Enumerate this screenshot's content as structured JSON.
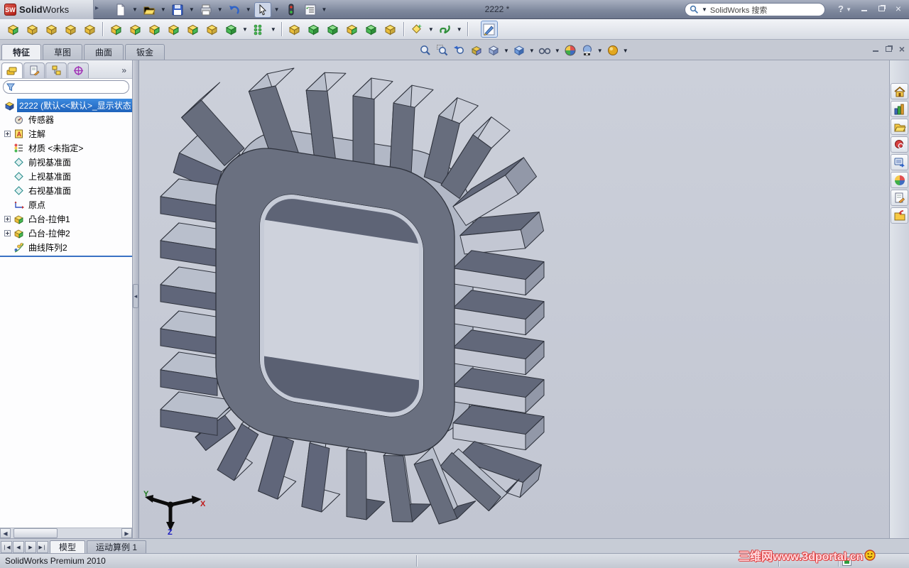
{
  "titlebar": {
    "app_name_bold": "Solid",
    "app_name_light": "Works",
    "doc_title": "2222 *",
    "search_placeholder": "SolidWorks 搜索",
    "help_label": "?"
  },
  "toolbar_main": [
    {
      "name": "new-document",
      "caret": true
    },
    {
      "name": "open-document",
      "caret": true
    },
    {
      "name": "save",
      "caret": true
    },
    {
      "name": "print",
      "caret": true
    },
    {
      "name": "undo",
      "caret": true
    },
    {
      "name": "select",
      "caret": true,
      "pressed": true
    },
    {
      "name": "rebuild",
      "caret": false
    },
    {
      "name": "options",
      "caret": true
    }
  ],
  "toolbar_features": [
    {
      "name": "extruded-boss",
      "v": "m"
    },
    {
      "name": "hinge",
      "v": "y"
    },
    {
      "name": "revolved-boss",
      "v": "y"
    },
    {
      "name": "swept-boss",
      "v": "y"
    },
    {
      "name": "lofted-boss",
      "v": "y"
    },
    {
      "sep": true
    },
    {
      "name": "extruded-cut",
      "v": "m"
    },
    {
      "name": "hole-wizard",
      "v": "m"
    },
    {
      "name": "revolved-cut",
      "v": "m"
    },
    {
      "name": "swept-cut",
      "v": "m"
    },
    {
      "name": "lofted-cut",
      "v": "m"
    },
    {
      "name": "boundary-boss",
      "v": "y"
    },
    {
      "name": "fillet",
      "v": "g",
      "caret": true
    },
    {
      "name": "linear-pattern",
      "v": "p",
      "caret": true
    },
    {
      "sep": true
    },
    {
      "name": "rib",
      "v": "y"
    },
    {
      "name": "draft",
      "v": "g"
    },
    {
      "name": "shell",
      "v": "g"
    },
    {
      "name": "wrap",
      "v": "m"
    },
    {
      "name": "dome",
      "v": "g"
    },
    {
      "name": "mirror",
      "v": "y"
    },
    {
      "sep": true
    },
    {
      "name": "reference-geometry",
      "v": "r",
      "caret": true
    },
    {
      "name": "curves",
      "v": "c",
      "caret": true
    },
    {
      "sep": true
    },
    {
      "name": "sketch",
      "v": "s",
      "highlighted": true
    }
  ],
  "command_tabs": [
    {
      "label": "特征",
      "active": true
    },
    {
      "label": "草图",
      "active": false
    },
    {
      "label": "曲面",
      "active": false
    },
    {
      "label": "钣金",
      "active": false
    }
  ],
  "manager_tabs": [
    "featuremanager-design-tree",
    "propertymanager",
    "configurationmanager",
    "dimxpertmanager"
  ],
  "manager_overflow": "»",
  "feature_tree": [
    {
      "label": "2222  (默认<<默认>_显示状态",
      "icon": "part",
      "selected": true,
      "expandable": false
    },
    {
      "label": "传感器",
      "icon": "sensors",
      "expandable": false
    },
    {
      "label": "注解",
      "icon": "annotations",
      "expandable": true
    },
    {
      "label": "材质 <未指定>",
      "icon": "material",
      "expandable": false
    },
    {
      "label": "前视基准面",
      "icon": "plane",
      "expandable": false
    },
    {
      "label": "上视基准面",
      "icon": "plane",
      "expandable": false
    },
    {
      "label": "右视基准面",
      "icon": "plane",
      "expandable": false
    },
    {
      "label": "原点",
      "icon": "origin",
      "expandable": false
    },
    {
      "label": "凸台-拉伸1",
      "icon": "extrude",
      "expandable": true
    },
    {
      "label": "凸台-拉伸2",
      "icon": "extrude",
      "expandable": true
    },
    {
      "label": "曲线阵列2",
      "icon": "pattern",
      "expandable": false
    }
  ],
  "view_toolbar": [
    {
      "name": "zoom-to-fit"
    },
    {
      "name": "zoom-to-area"
    },
    {
      "name": "previous-view"
    },
    {
      "name": "section-view"
    },
    {
      "name": "view-orientation",
      "caret": true
    },
    {
      "name": "display-style",
      "caret": true
    },
    {
      "name": "hide-show-items",
      "caret": true
    },
    {
      "name": "edit-appearance"
    },
    {
      "name": "apply-scene",
      "caret": true
    },
    {
      "name": "view-settings",
      "caret": true
    }
  ],
  "task_pane": [
    "solidworks-resources",
    "design-library",
    "file-explorer",
    "solidworks-search",
    "view-palette",
    "appearances-scenes",
    "custom-properties",
    "document-recovery"
  ],
  "triad": {
    "x": "X",
    "y": "Y",
    "z": "Z"
  },
  "bottom": {
    "nav": [
      "first",
      "previous",
      "next",
      "last"
    ],
    "tabs": [
      {
        "label": "模型",
        "active": true
      },
      {
        "label": "运动算例 1",
        "active": false
      }
    ]
  },
  "statusbar": {
    "text": "SolidWorks Premium 2010"
  },
  "watermark": {
    "text": "三维网www.3dportal.cn"
  },
  "colors": {
    "viewport_bg": "#c6cad5",
    "model_dark_face": "#676d7d",
    "model_light_face": "#b9bfcc",
    "selection_blue": "#2f6fce",
    "watermark_red": "#e04444"
  }
}
